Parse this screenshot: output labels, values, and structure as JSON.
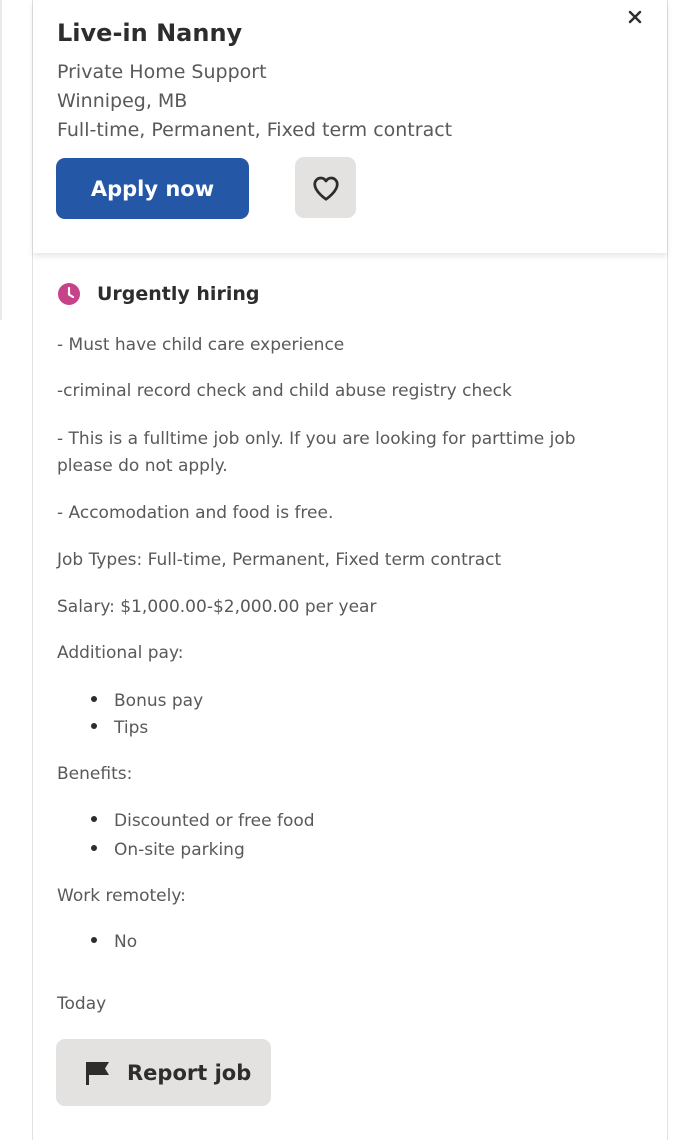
{
  "job": {
    "title": "Live-in Nanny",
    "company": "Private Home Support",
    "location": "Winnipeg, MB",
    "job_types": "Full-time, Permanent, Fixed term contract",
    "apply_label": "Apply now",
    "save_icon": "heart-outline-icon",
    "close_icon": "close-icon"
  },
  "description": {
    "urgent_label": "Urgently hiring",
    "urgent_icon": "clock-icon",
    "urgent_color": "#c74289",
    "lines": [
      "- Must have child care experience",
      "-criminal record check and child abuse registry check",
      "- This is a fulltime job only. If you are looking for parttime job",
      "please do not apply.",
      "- Accomodation and food is free.",
      "Job Types: Full-time, Permanent, Fixed term contract",
      "Salary: $1,000.00-$2,000.00 per year"
    ],
    "additional_pay_label": "Additional pay:",
    "additional_pay": [
      "Bonus pay",
      "Tips"
    ],
    "benefits_label": "Benefits:",
    "benefits": [
      "Discounted or free food",
      "On-site parking"
    ],
    "work_remotely_label": "Work remotely:",
    "work_remotely": [
      "No"
    ],
    "posted": "Today"
  },
  "report": {
    "label": "Report job",
    "icon": "flag-icon"
  },
  "colors": {
    "primary": "#2557a7",
    "button_gray": "#e4e2e0",
    "text_dark": "#2d2d2d",
    "text_muted": "#595959"
  }
}
